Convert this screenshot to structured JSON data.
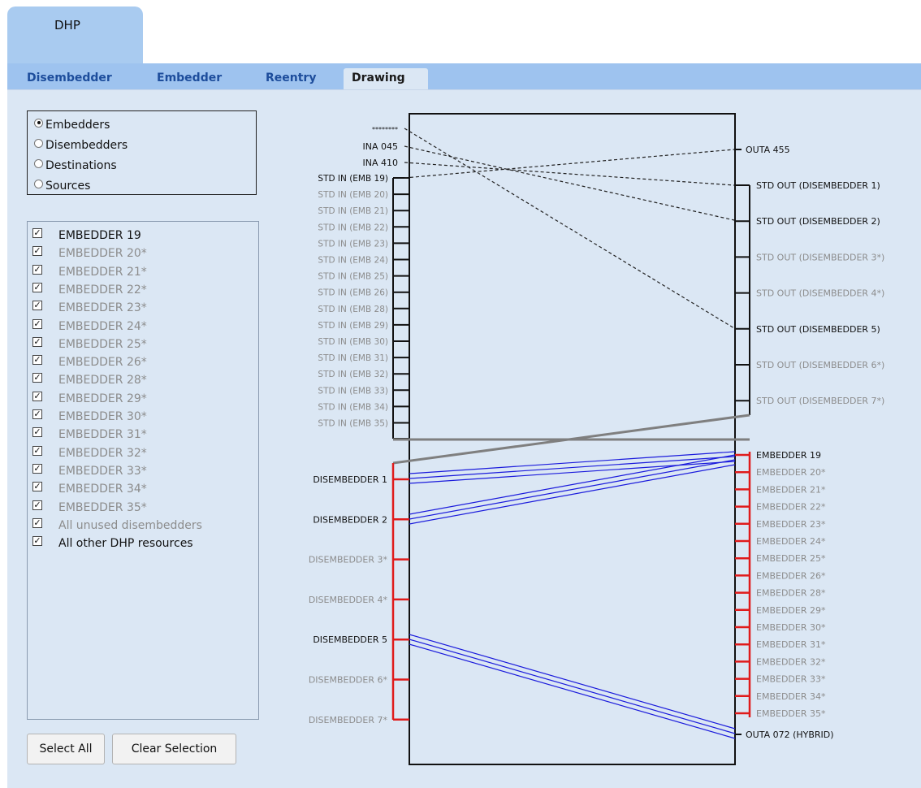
{
  "app": {
    "title": "DHP"
  },
  "tabs": [
    {
      "label": "Disembedder",
      "active": false
    },
    {
      "label": "Embedder",
      "active": false
    },
    {
      "label": "Reentry",
      "active": false
    },
    {
      "label": "Drawing",
      "active": true
    }
  ],
  "view_options": [
    {
      "label": "Embedders",
      "selected": true
    },
    {
      "label": "Disembedders",
      "selected": false
    },
    {
      "label": "Destinations",
      "selected": false
    },
    {
      "label": "Sources",
      "selected": false
    }
  ],
  "filter_items": [
    {
      "label": "EMBEDDER 19",
      "checked": true,
      "dim": false
    },
    {
      "label": "EMBEDDER 20*",
      "checked": true,
      "dim": true
    },
    {
      "label": "EMBEDDER 21*",
      "checked": true,
      "dim": true
    },
    {
      "label": "EMBEDDER 22*",
      "checked": true,
      "dim": true
    },
    {
      "label": "EMBEDDER 23*",
      "checked": true,
      "dim": true
    },
    {
      "label": "EMBEDDER 24*",
      "checked": true,
      "dim": true
    },
    {
      "label": "EMBEDDER 25*",
      "checked": true,
      "dim": true
    },
    {
      "label": "EMBEDDER 26*",
      "checked": true,
      "dim": true
    },
    {
      "label": "EMBEDDER 28*",
      "checked": true,
      "dim": true
    },
    {
      "label": "EMBEDDER 29*",
      "checked": true,
      "dim": true
    },
    {
      "label": "EMBEDDER 30*",
      "checked": true,
      "dim": true
    },
    {
      "label": "EMBEDDER 31*",
      "checked": true,
      "dim": true
    },
    {
      "label": "EMBEDDER 32*",
      "checked": true,
      "dim": true
    },
    {
      "label": "EMBEDDER 33*",
      "checked": true,
      "dim": true
    },
    {
      "label": "EMBEDDER 34*",
      "checked": true,
      "dim": true
    },
    {
      "label": "EMBEDDER 35*",
      "checked": true,
      "dim": true
    },
    {
      "label": "All unused disembedders",
      "checked": true,
      "dim": true
    },
    {
      "label": "All other DHP resources",
      "checked": true,
      "dim": false
    }
  ],
  "buttons": {
    "select_all": "Select All",
    "clear_selection": "Clear Selection"
  },
  "colors": {
    "active_text": "#111111",
    "dim_text": "#8c8c8c",
    "link_blue": "#1b1bdc",
    "bracket_red": "#e01b1b",
    "divider_gray": "#7f7f7f"
  },
  "diagram": {
    "top_left_labels": [
      {
        "label": "********",
        "dim": false
      },
      {
        "label": "INA 045",
        "dim": false
      },
      {
        "label": "INA 410",
        "dim": false
      }
    ],
    "std_in": [
      {
        "label": "STD IN (EMB 19)",
        "dim": false
      },
      {
        "label": "STD IN (EMB 20)",
        "dim": true
      },
      {
        "label": "STD IN (EMB 21)",
        "dim": true
      },
      {
        "label": "STD IN (EMB 22)",
        "dim": true
      },
      {
        "label": "STD IN (EMB 23)",
        "dim": true
      },
      {
        "label": "STD IN (EMB 24)",
        "dim": true
      },
      {
        "label": "STD IN (EMB 25)",
        "dim": true
      },
      {
        "label": "STD IN (EMB 26)",
        "dim": true
      },
      {
        "label": "STD IN (EMB 28)",
        "dim": true
      },
      {
        "label": "STD IN (EMB 29)",
        "dim": true
      },
      {
        "label": "STD IN (EMB 30)",
        "dim": true
      },
      {
        "label": "STD IN (EMB 31)",
        "dim": true
      },
      {
        "label": "STD IN (EMB 32)",
        "dim": true
      },
      {
        "label": "STD IN (EMB 33)",
        "dim": true
      },
      {
        "label": "STD IN (EMB 34)",
        "dim": true
      },
      {
        "label": "STD IN (EMB 35)",
        "dim": true
      }
    ],
    "outa_top": "OUTA 455",
    "std_out": [
      {
        "label": "STD OUT (DISEMBEDDER 1)",
        "dim": false
      },
      {
        "label": "STD OUT (DISEMBEDDER 2)",
        "dim": false
      },
      {
        "label": "STD OUT (DISEMBEDDER 3*)",
        "dim": true
      },
      {
        "label": "STD OUT (DISEMBEDDER 4*)",
        "dim": true
      },
      {
        "label": "STD OUT (DISEMBEDDER 5)",
        "dim": false
      },
      {
        "label": "STD OUT (DISEMBEDDER 6*)",
        "dim": true
      },
      {
        "label": "STD OUT (DISEMBEDDER 7*)",
        "dim": true
      }
    ],
    "disembedders": [
      {
        "label": "DISEMBEDDER 1",
        "dim": false
      },
      {
        "label": "DISEMBEDDER 2",
        "dim": false
      },
      {
        "label": "DISEMBEDDER 3*",
        "dim": true
      },
      {
        "label": "DISEMBEDDER 4*",
        "dim": true
      },
      {
        "label": "DISEMBEDDER 5",
        "dim": false
      },
      {
        "label": "DISEMBEDDER 6*",
        "dim": true
      },
      {
        "label": "DISEMBEDDER 7*",
        "dim": true
      }
    ],
    "embedders": [
      {
        "label": "EMBEDDER 19",
        "dim": false
      },
      {
        "label": "EMBEDDER 20*",
        "dim": true
      },
      {
        "label": "EMBEDDER 21*",
        "dim": true
      },
      {
        "label": "EMBEDDER 22*",
        "dim": true
      },
      {
        "label": "EMBEDDER 23*",
        "dim": true
      },
      {
        "label": "EMBEDDER 24*",
        "dim": true
      },
      {
        "label": "EMBEDDER 25*",
        "dim": true
      },
      {
        "label": "EMBEDDER 26*",
        "dim": true
      },
      {
        "label": "EMBEDDER 28*",
        "dim": true
      },
      {
        "label": "EMBEDDER 29*",
        "dim": true
      },
      {
        "label": "EMBEDDER 30*",
        "dim": true
      },
      {
        "label": "EMBEDDER 31*",
        "dim": true
      },
      {
        "label": "EMBEDDER 32*",
        "dim": true
      },
      {
        "label": "EMBEDDER 33*",
        "dim": true
      },
      {
        "label": "EMBEDDER 34*",
        "dim": true
      },
      {
        "label": "EMBEDDER 35*",
        "dim": true
      }
    ],
    "outa_bottom": "OUTA 072 (HYBRID)"
  }
}
